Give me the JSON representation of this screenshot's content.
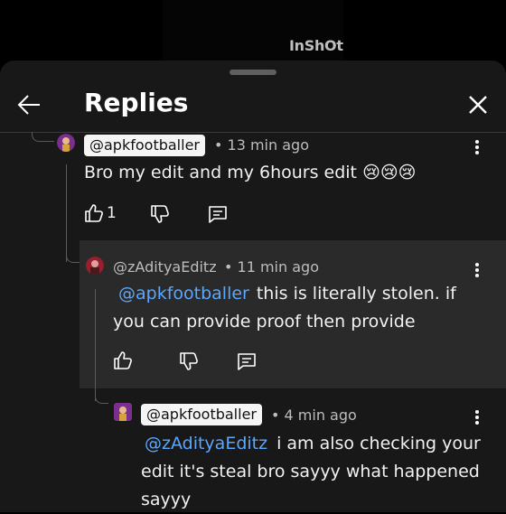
{
  "watermark": "InShOt",
  "header": {
    "title": "Replies"
  },
  "replies": [
    {
      "handle": "@apkfootballer",
      "meta": "• 13 min ago",
      "text": "Bro my edit and my 6hours edit",
      "emoji": "😢😢😢",
      "likes": "1"
    },
    {
      "handle": "@zAdityaEditz",
      "meta": "• 11 min ago",
      "mention": "@apkfootballer",
      "text_line1": "this is literally stolen. if",
      "text_line2": "you can provide proof then provide"
    },
    {
      "handle": "@apkfootballer",
      "meta": "• 4 min ago",
      "mention": "@zAdityaEditz",
      "text_line1": "i am also checking your",
      "text_line2": "edit it's steal bro sayyy what happened",
      "text_line3": "sayyy"
    }
  ],
  "colors": {
    "sheet": "#181818",
    "highlight": "#2a2a2a",
    "mention": "#5aa7ff"
  }
}
